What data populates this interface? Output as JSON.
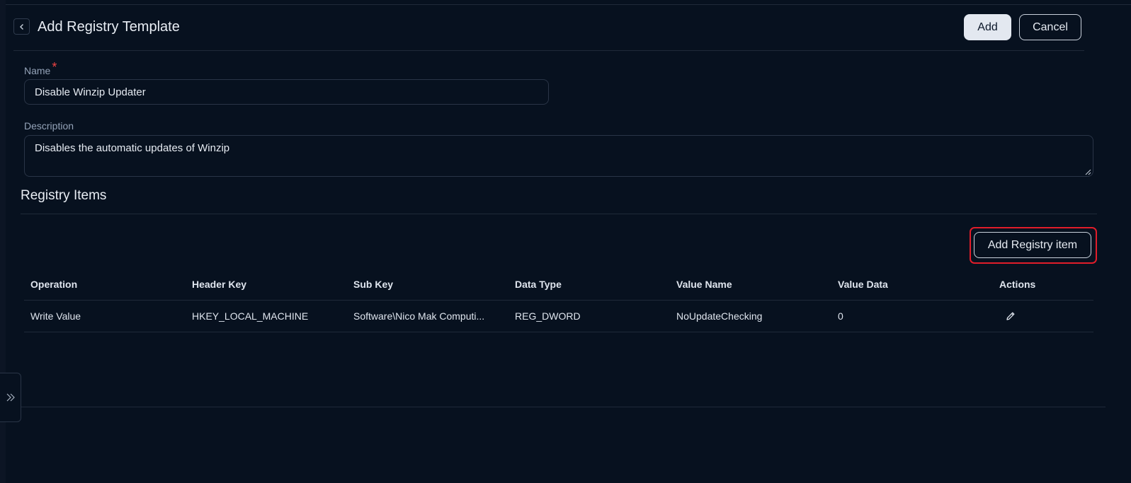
{
  "header": {
    "title": "Add Registry Template",
    "add_label": "Add",
    "cancel_label": "Cancel"
  },
  "form": {
    "name_label": "Name",
    "required_mark": "*",
    "name_value": "Disable Winzip Updater",
    "description_label": "Description",
    "description_value": "Disables the automatic updates of Winzip"
  },
  "registry": {
    "section_title": "Registry Items",
    "add_item_label": "Add Registry item",
    "columns": [
      "Operation",
      "Header Key",
      "Sub Key",
      "Data Type",
      "Value Name",
      "Value Data",
      "Actions"
    ],
    "rows": [
      {
        "operation": "Write Value",
        "header_key": "HKEY_LOCAL_MACHINE",
        "sub_key": "Software\\Nico Mak Computi...",
        "data_type": "REG_DWORD",
        "value_name": "NoUpdateChecking",
        "value_data": "0"
      }
    ]
  },
  "colors": {
    "background": "#07111f",
    "highlight": "#e11d2a",
    "primary_button": "#e3e8f0"
  },
  "icons": {
    "back": "chevron-left-icon",
    "edit": "pencil-icon",
    "sidebar_toggle": "double-chevron-right-icon"
  }
}
